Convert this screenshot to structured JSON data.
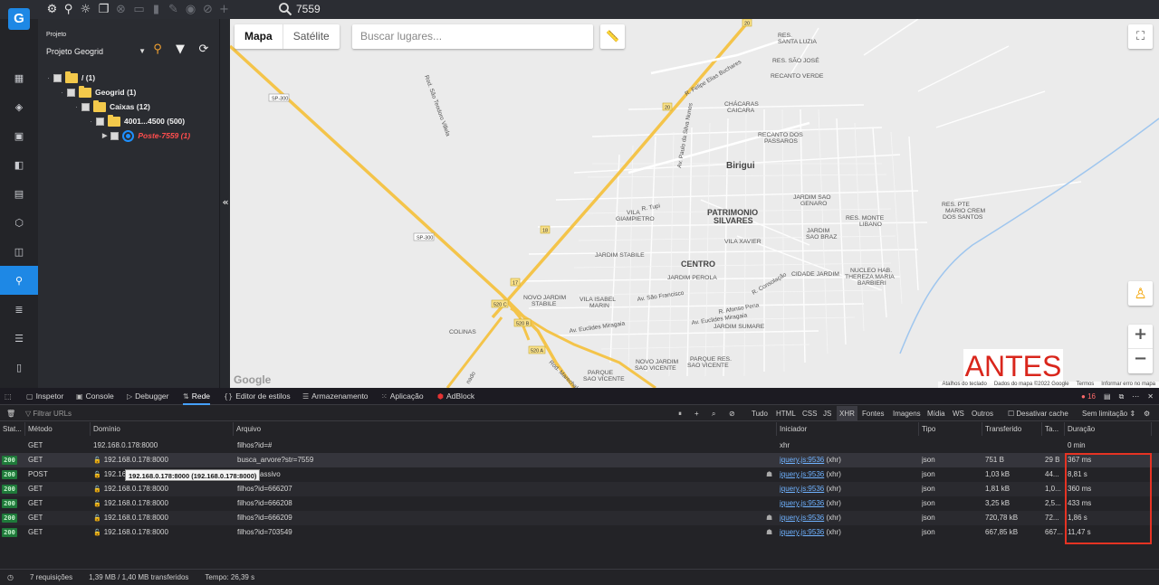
{
  "app": {
    "logo_text": "G",
    "search_value": "7559"
  },
  "sidebar": {
    "project_label": "Projeto",
    "project_value": "Projeto Geogrid",
    "tree": [
      {
        "label": "/ (1)"
      },
      {
        "label": "Geogrid (1)"
      },
      {
        "label": "Caixas (12)"
      },
      {
        "label": "4001...4500 (500)"
      },
      {
        "label": "Poste-7559 (1)"
      }
    ]
  },
  "map": {
    "type_tabs": [
      "Mapa",
      "Satélite"
    ],
    "search_placeholder": "Buscar lugares...",
    "annotation": "ANTES",
    "google_logo": "Google",
    "footer": [
      "Atalhos do teclado",
      "Dados do mapa ©2022 Google",
      "Termos",
      "Informar erro no mapa"
    ],
    "zoom_in": "+",
    "zoom_out": "−",
    "labels": {
      "biriguí": "Birigui",
      "patrimonio": "PATRIMONIO",
      "silvares": "SILVARES",
      "centro": "CENTRO",
      "res_santa_luzia_1": "RES.",
      "res_santa_luzia_2": "SANTA LUZIA",
      "res_sao_jose": "RES. SÃO JOSÉ",
      "recanto_verde": "RECANTO VERDE",
      "chacaras_1": "CHÁCARAS",
      "chacaras_2": "CAICARA",
      "recanto_passaros_1": "RECANTO DOS",
      "recanto_passaros_2": "PASSAROS",
      "vila_giampietro_1": "VILA",
      "vila_giampietro_2": "GIAMPIETRO",
      "jardim_sao_genaro_1": "JARDIM SAO",
      "jardim_sao_genaro_2": "GENARO",
      "res_monte_libano_1": "RES. MONTE",
      "res_monte_libano_2": "LIBANO",
      "jardim_sao_braz_1": "JARDIM",
      "jardim_sao_braz_2": "SAO BRAZ",
      "res_mario_1": "RES. PTE",
      "res_mario_2": "MARIO CREM",
      "res_mario_3": "DOS SANTOS",
      "vila_xavier": "VILA XAVIER",
      "jardim_stabile": "JARDIM STABILE",
      "jardim_perola": "JARDIM PEROLA",
      "cidade_jardim": "CIDADE JARDIM",
      "nucleo_1": "NUCLEO HAB.",
      "nucleo_2": "THEREZA MARIA",
      "nucleo_3": "BARBIERI",
      "novo_stabile_1": "NOVO JARDIM",
      "novo_stabile_2": "STABILE",
      "vila_isabel_1": "VILA ISABEL",
      "vila_isabel_2": "MARIN",
      "jardim_sumare": "JARDIM SUMARE",
      "colinas": "COLINAS",
      "novo_sao_vicente_1": "NOVO JARDIM",
      "novo_sao_vicente_2": "SAO VICENTE",
      "parque_res_1": "PARQUE RES.",
      "parque_res_2": "SAO VICENTE",
      "parque_res2_1": "PARQUE",
      "parque_res2_2": "SAO VICENTE",
      "av_sao_francisco": "Av. São Francisco",
      "av_euclides_1": "Av. Euclides Miragaia",
      "av_euclides_2": "Av. Euclides Miragaia",
      "r_afonso_pena": "R. Afonso Pena",
      "r_consolacao": "R. Consolação",
      "r_tupi": "R. Tupi",
      "r_felipe": "R. Felipe Elias Buchares",
      "av_paulo": "Av. Paulo da Silva Nunes",
      "rod_sao_teodoro": "Rod. São Teodoro Villela",
      "rod_marechal": "Rod. Marechal",
      "r_nado": "nado",
      "sp300_1": "SP-300",
      "sp300_2": "SP-300",
      "sh_20a": "20",
      "sh_20b": "20",
      "sh_18": "18",
      "sh_17": "17",
      "sh_520c": "520 C",
      "sh_520b": "520 B",
      "sh_520a": "520 A"
    }
  },
  "devtools": {
    "tabs": [
      "Inspetor",
      "Console",
      "Debugger",
      "Rede",
      "Editor de estilos",
      "Armazenamento",
      "Aplicação",
      "AdBlock"
    ],
    "error_count": "16",
    "filter_placeholder": "Filtrar URLs",
    "filter_types": [
      "Tudo",
      "HTML",
      "CSS",
      "JS",
      "XHR",
      "Fontes",
      "Imagens",
      "Mídia",
      "WS",
      "Outros"
    ],
    "disable_cache": "Desativar cache",
    "throttle": "Sem limitação ⇕",
    "columns": [
      "Stat...",
      "Método",
      "Domínio",
      "Arquivo",
      "Iniciador",
      "Tipo",
      "Transferido",
      "Ta...",
      "Duração"
    ],
    "tooltip": "192.168.0.178:8000 (192.168.0.178:8000)",
    "rows": [
      {
        "status": "",
        "method": "GET",
        "domain": "192.168.0.178:8000",
        "file": "filhos?id=#",
        "initiator": "xhr",
        "type": "",
        "transferred": "",
        "size": "",
        "duration": "0 min"
      },
      {
        "status": "200",
        "method": "GET",
        "domain": "192.168.0.178:8000",
        "file": "busca_arvore?str=7559",
        "initiator": "jquery.js:9536",
        "initiator_suffix": "(xhr)",
        "type": "json",
        "transferred": "751 B",
        "size": "29 B",
        "duration": "367 ms"
      },
      {
        "status": "200",
        "method": "POST",
        "domain": "192.168.0.178:8000",
        "file": "assivo",
        "initiator": "jquery.js:9536",
        "initiator_suffix": "(xhr)",
        "type": "json",
        "transferred": "1,03 kB",
        "size": "44...",
        "duration": "8,81 s"
      },
      {
        "status": "200",
        "method": "GET",
        "domain": "192.168.0.178:8000",
        "file": "filhos?id=666207",
        "initiator": "jquery.js:9536",
        "initiator_suffix": "(xhr)",
        "type": "json",
        "transferred": "1,81 kB",
        "size": "1,0...",
        "duration": "360 ms"
      },
      {
        "status": "200",
        "method": "GET",
        "domain": "192.168.0.178:8000",
        "file": "filhos?id=666208",
        "initiator": "jquery.js:9536",
        "initiator_suffix": "(xhr)",
        "type": "json",
        "transferred": "3,25 kB",
        "size": "2,5...",
        "duration": "433 ms"
      },
      {
        "status": "200",
        "method": "GET",
        "domain": "192.168.0.178:8000",
        "file": "filhos?id=666209",
        "initiator": "jquery.js:9536",
        "initiator_suffix": "(xhr)",
        "type": "json",
        "transferred": "720,78 kB",
        "size": "72...",
        "duration": "1,86 s"
      },
      {
        "status": "200",
        "method": "GET",
        "domain": "192.168.0.178:8000",
        "file": "filhos?id=703549",
        "initiator": "jquery.js:9536",
        "initiator_suffix": "(xhr)",
        "type": "json",
        "transferred": "667,85 kB",
        "size": "667...",
        "duration": "11,47 s"
      }
    ],
    "status_requests": "7 requisições",
    "status_transferred": "1,39 MB / 1,40 MB transferidos",
    "status_time": "Tempo: 26,39 s"
  }
}
